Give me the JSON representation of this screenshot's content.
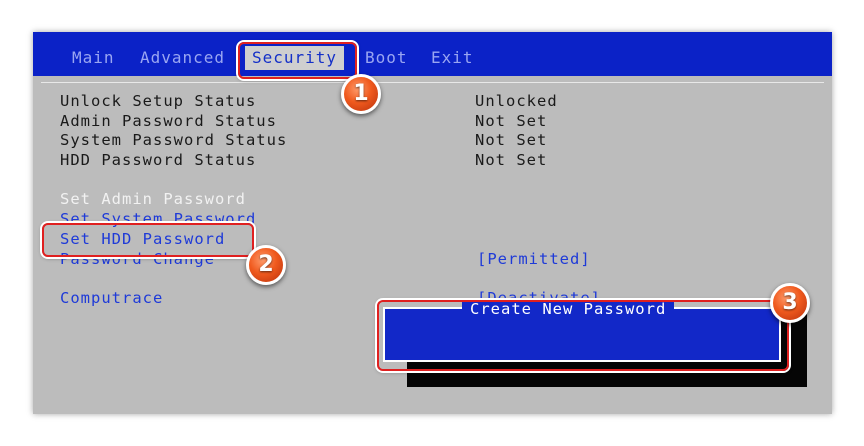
{
  "menu": {
    "items": [
      "Main",
      "Advanced",
      "Security",
      "Boot",
      "Exit"
    ]
  },
  "status": [
    {
      "label": "Unlock Setup Status",
      "value": "Unlocked"
    },
    {
      "label": "Admin Password Status",
      "value": "Not Set"
    },
    {
      "label": "System Password Status",
      "value": "Not Set"
    },
    {
      "label": "HDD Password Status",
      "value": "Not Set"
    }
  ],
  "options": {
    "set_admin": "Set Admin Password",
    "set_system": "Set System Password",
    "set_hdd": "Set HDD Password",
    "password_change": "Password Change",
    "password_change_value": "[Permitted]",
    "computrace": "Computrace",
    "computrace_value": "[Deactivate]"
  },
  "dialog": {
    "title": "Create New Password",
    "input_value": ""
  },
  "badges": [
    "1",
    "2",
    "3"
  ],
  "colors": {
    "bios_gray": "#bcbcbc",
    "bios_blue": "#0b22c7",
    "link_blue": "#1e3ad8",
    "highlight_red": "#e02020",
    "badge_orange": "#f05a1e"
  }
}
